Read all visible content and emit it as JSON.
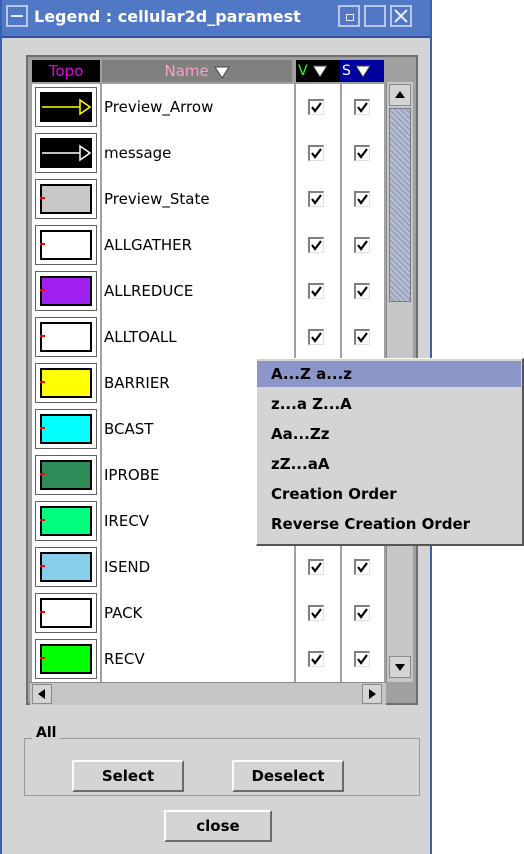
{
  "window": {
    "title": "Legend : cellular2d_paramest"
  },
  "table": {
    "headers": {
      "topo": "Topo",
      "name": "Name",
      "v": "V",
      "s": "S"
    },
    "rows": [
      {
        "name": "Preview_Arrow",
        "type": "arrow",
        "color": "#000000",
        "accent": "#ffff00",
        "v": true,
        "s": true
      },
      {
        "name": "message",
        "type": "arrow",
        "color": "#000000",
        "accent": "#ffffff",
        "v": true,
        "s": true
      },
      {
        "name": "Preview_State",
        "type": "state",
        "color": "#c8c8c8",
        "v": true,
        "s": true
      },
      {
        "name": "ALLGATHER",
        "type": "state",
        "color": "#ffffff",
        "v": true,
        "s": true
      },
      {
        "name": "ALLREDUCE",
        "type": "state",
        "color": "#a020f0",
        "v": true,
        "s": true
      },
      {
        "name": "ALLTOALL",
        "type": "state",
        "color": "#ffffff",
        "v": true,
        "s": true
      },
      {
        "name": "BARRIER",
        "type": "state",
        "color": "#ffff00",
        "v": true,
        "s": true
      },
      {
        "name": "BCAST",
        "type": "state",
        "color": "#00ffff",
        "v": true,
        "s": true
      },
      {
        "name": "IPROBE",
        "type": "state",
        "color": "#2e8b57",
        "v": true,
        "s": true
      },
      {
        "name": "IRECV",
        "type": "state",
        "color": "#00ff7f",
        "v": true,
        "s": true
      },
      {
        "name": "ISEND",
        "type": "state",
        "color": "#87ceeb",
        "v": true,
        "s": true
      },
      {
        "name": "PACK",
        "type": "state",
        "color": "#ffffff",
        "v": true,
        "s": true
      },
      {
        "name": "RECV",
        "type": "state",
        "color": "#00ff00",
        "v": true,
        "s": true
      }
    ]
  },
  "sort_menu": {
    "items": [
      "A...Z a...z",
      "z...a Z...A",
      "Aa...Zz",
      "zZ...aA",
      "Creation Order",
      "Reverse Creation Order"
    ],
    "selected_index": 0
  },
  "all_group": {
    "label": "All",
    "select_label": "Select",
    "deselect_label": "Deselect"
  },
  "close_label": "close",
  "icons": {
    "window_menu": "minus-icon",
    "minimize": "minimize-icon",
    "maximize": "maximize-icon",
    "close": "close-x-icon",
    "sort": "triangle-down-icon",
    "check": "check-icon"
  }
}
